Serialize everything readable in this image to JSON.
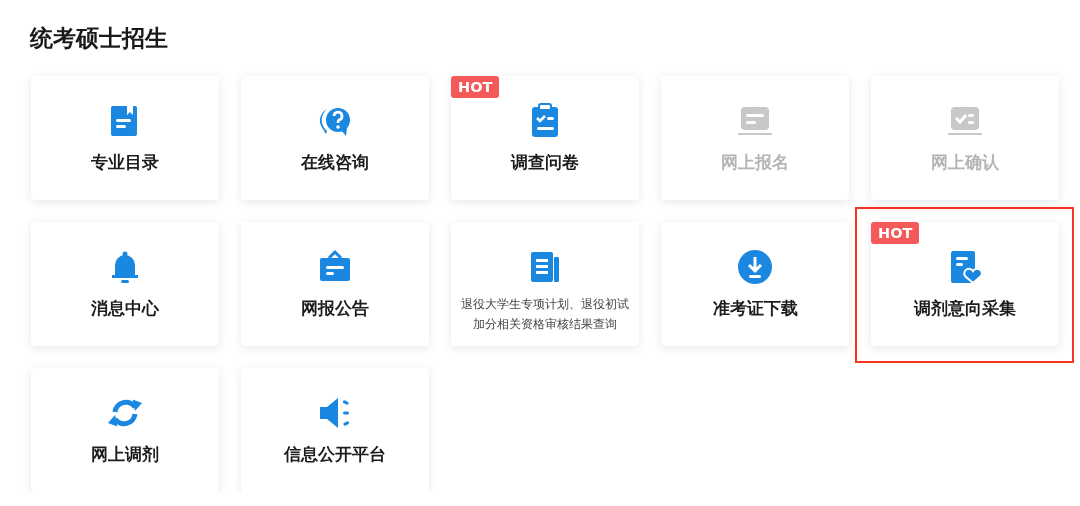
{
  "title": "统考硕士招生",
  "tiles": [
    {
      "label": "专业目录",
      "kind": "normal",
      "disabled": false,
      "highlighted": false
    },
    {
      "label": "在线咨询",
      "kind": "normal",
      "disabled": false,
      "highlighted": false
    },
    {
      "label": "调查问卷",
      "kind": "normal",
      "disabled": false,
      "highlighted": false,
      "badge": "HOT"
    },
    {
      "label": "网上报名",
      "kind": "normal",
      "disabled": true,
      "highlighted": false
    },
    {
      "label": "网上确认",
      "kind": "normal",
      "disabled": true,
      "highlighted": false
    },
    {
      "label": "消息中心",
      "kind": "normal",
      "disabled": false,
      "highlighted": false
    },
    {
      "label": "网报公告",
      "kind": "normal",
      "disabled": false,
      "highlighted": false
    },
    {
      "label": "退役大学生专项计划、退役初试加分相关资格审核结果查询",
      "kind": "note",
      "disabled": false,
      "highlighted": false
    },
    {
      "label": "准考证下载",
      "kind": "normal",
      "disabled": false,
      "highlighted": false
    },
    {
      "label": "调剂意向采集",
      "kind": "normal",
      "disabled": false,
      "highlighted": true,
      "badge": "HOT"
    },
    {
      "label": "网上调剂",
      "kind": "normal",
      "disabled": false,
      "highlighted": false
    },
    {
      "label": "信息公开平台",
      "kind": "normal",
      "disabled": false,
      "highlighted": false
    }
  ]
}
